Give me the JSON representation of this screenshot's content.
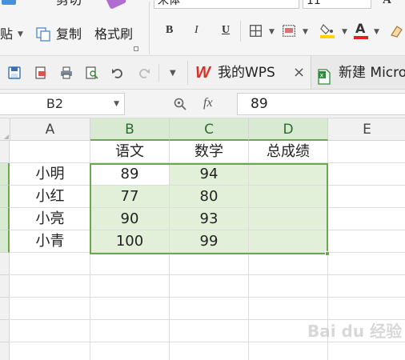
{
  "ribbon": {
    "cut_label": "剪切",
    "paste_label": "贴",
    "copy_label": "复制",
    "format_painter_label": "格式刷",
    "font_name": "宋体",
    "font_size": "11",
    "bold_label": "B",
    "italic_label": "I",
    "underline_label": "U",
    "font_color_label": "A",
    "font_color": "#e02020",
    "fill_color": "#ffd400"
  },
  "tabbar": {
    "tabs": [
      {
        "label": "我的WPS",
        "close": "×"
      },
      {
        "label": "新建 Micro"
      }
    ]
  },
  "formula_bar": {
    "name_box": "B2",
    "fx_label": "fx",
    "value": "89"
  },
  "sheet": {
    "columns": [
      "A",
      "B",
      "C",
      "D",
      "E"
    ],
    "header_row": [
      "",
      "语文",
      "数学",
      "总成绩"
    ],
    "rows": [
      {
        "name": "小明",
        "chinese": "89",
        "math": "94",
        "total": ""
      },
      {
        "name": "小红",
        "chinese": "77",
        "math": "80",
        "total": ""
      },
      {
        "name": "小亮",
        "chinese": "90",
        "math": "93",
        "total": ""
      },
      {
        "name": "小青",
        "chinese": "100",
        "math": "99",
        "total": ""
      }
    ],
    "selection": "B2:D5",
    "accent": "#6aa84f",
    "selection_fill": "#e2f0d9"
  },
  "watermark": "Bai du 经验"
}
